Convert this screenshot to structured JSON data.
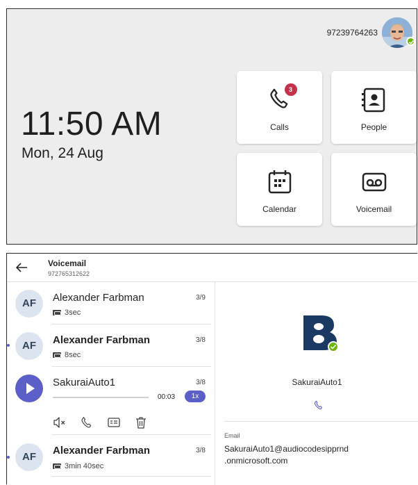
{
  "home": {
    "account_number": "97239764263",
    "time": "11:50 AM",
    "date": "Mon, 24 Aug",
    "tiles": [
      {
        "label": "Calls",
        "badge": "3",
        "icon": "phone-icon"
      },
      {
        "label": "People",
        "icon": "contact-card-icon"
      },
      {
        "label": "Calendar",
        "icon": "calendar-icon"
      },
      {
        "label": "Voicemail",
        "icon": "voicemail-icon"
      }
    ],
    "presence_color": "#6bb700",
    "badge_color": "#c4314b"
  },
  "voicemail": {
    "title": "Voicemail",
    "subtitle": "972765312622",
    "items": [
      {
        "initials": "AF",
        "name": "Alexander Farbman",
        "duration": "3sec",
        "date": "3/9",
        "unread": false
      },
      {
        "initials": "AF",
        "name": "Alexander Farbman",
        "duration": "8sec",
        "date": "3/8",
        "unread": true
      },
      {
        "name": "SakuraiAuto1",
        "date": "3/8",
        "elapsed": "00:03",
        "speed": "1x",
        "playing": true
      },
      {
        "initials": "AF",
        "name": "Alexander Farbman",
        "duration": "3min 40sec",
        "date": "3/8",
        "unread": true
      }
    ],
    "player_actions": [
      "mute-icon",
      "call-icon",
      "contact-card-icon",
      "delete-icon"
    ],
    "detail": {
      "name": "SakuraiAuto1",
      "email_label": "Email",
      "email": "SakuraiAuto1@audiocodesipprnd.onmicrosoft.com",
      "email_line1": "SakuraiAuto1@audiocodesipprnd",
      "email_line2": ".onmicrosoft.com"
    },
    "accent_color": "#5b5fc7"
  }
}
